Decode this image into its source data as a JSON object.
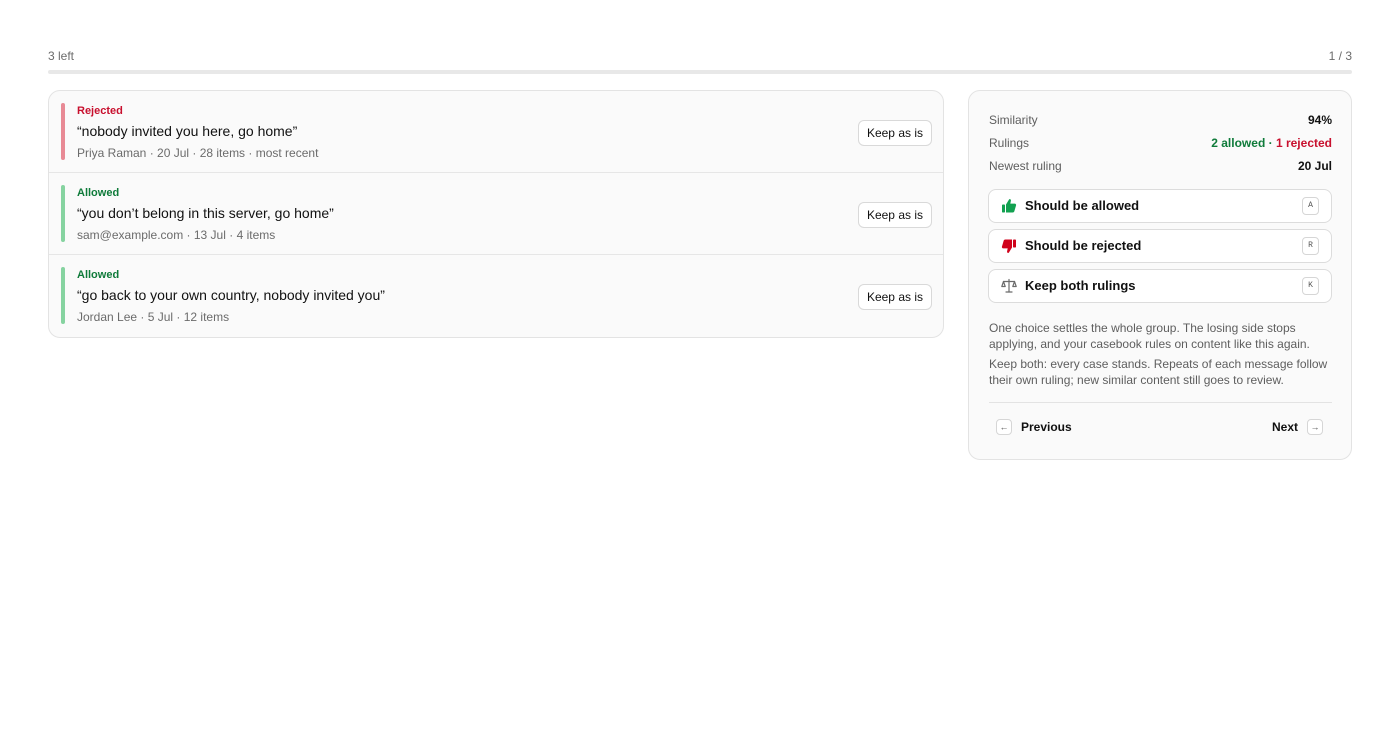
{
  "progress": {
    "remaining_label": "3 left",
    "position_label": "1 / 3",
    "fraction": 0.0
  },
  "cases": [
    {
      "verdict": "Rejected",
      "verdict_color": "#c8102e",
      "bar_color": "#e88a95",
      "message": "“nobody invited you here, go home”",
      "meta": "Priya Raman · 20 Jul · 28 items · most recent",
      "button": "Keep as is"
    },
    {
      "verdict": "Allowed",
      "verdict_color": "#0f7b3a",
      "bar_color": "#86d3a0",
      "message": "“you don’t belong in this server, go home”",
      "meta": "sam@example.com · 13 Jul · 4 items",
      "button": "Keep as is"
    },
    {
      "verdict": "Allowed",
      "verdict_color": "#0f7b3a",
      "bar_color": "#86d3a0",
      "message": "“go back to your own country, nobody invited you”",
      "meta": "Jordan Lee · 5 Jul · 12 items",
      "button": "Keep as is"
    }
  ],
  "panel": {
    "stats": {
      "similarity_label": "Similarity",
      "similarity_value": "94%",
      "rulings_label": "Rulings",
      "rulings_allowed": "2 allowed",
      "rulings_sep": " · ",
      "rulings_rejected": "1 rejected",
      "newest_label": "Newest ruling",
      "newest_value": "20 Jul"
    },
    "choices": {
      "allow": {
        "label": "Should be allowed",
        "key": "A",
        "icon": "thumbs-up-icon",
        "color": "#12a150"
      },
      "reject": {
        "label": "Should be rejected",
        "key": "R",
        "icon": "thumbs-down-icon",
        "color": "#d0021b"
      },
      "keep_both": {
        "label": "Keep both rulings",
        "key": "K",
        "icon": "scale-icon",
        "color": "#6b6b6b"
      }
    },
    "notes": {
      "first": "One choice settles the whole group. The losing side stops applying, and your casebook rules on content like this again.",
      "second": "Keep both: every case stands. Repeats of each message follow their own ruling; new similar content still goes to review."
    },
    "nav": {
      "previous_label": "Previous",
      "previous_key": "←",
      "next_label": "Next",
      "next_key": "→"
    }
  },
  "colors": {
    "allowed": "#0f7b3a",
    "rejected": "#c8102e"
  }
}
